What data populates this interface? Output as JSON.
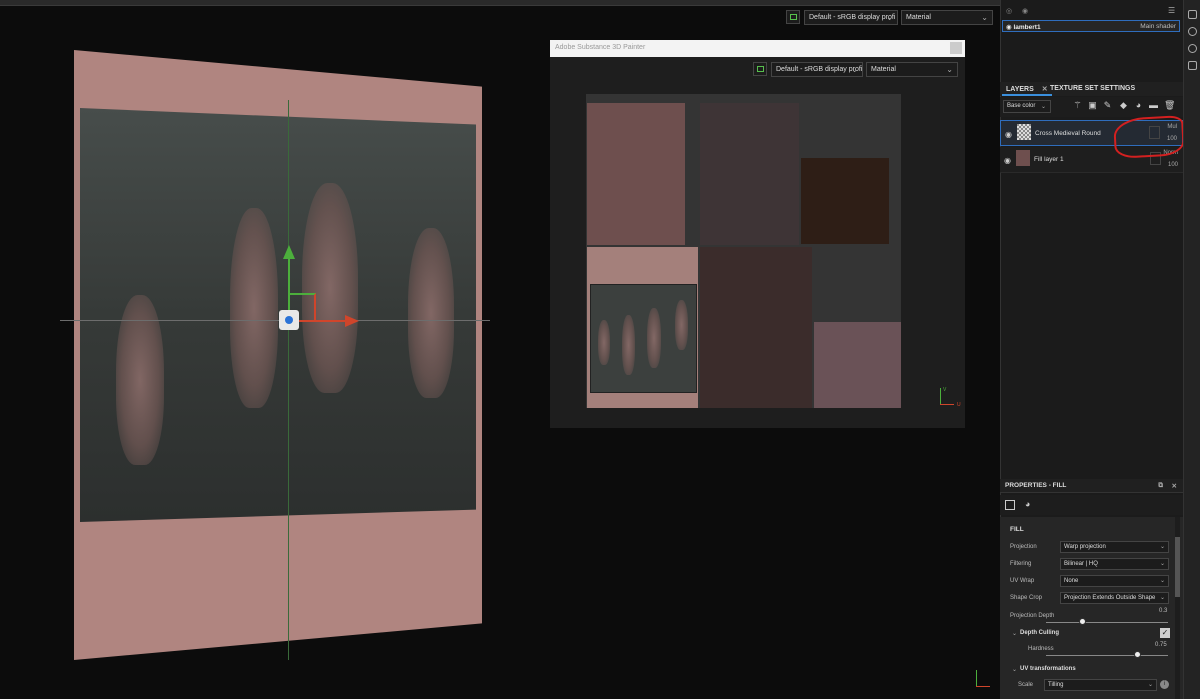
{
  "viewport3d": {
    "color_profile": "Default - sRGB display profi",
    "channel": "Material"
  },
  "uv_window": {
    "title": "Adobe Substance 3D Painter",
    "color_profile": "Default - sRGB display profi",
    "channel": "Material",
    "axis_v": "V",
    "axis_u": "U"
  },
  "shader": {
    "name": "lambert1",
    "type": "Main shader"
  },
  "tabs": [
    {
      "label": "LAYERS",
      "active": true
    },
    {
      "label": "TEXTURE SET SETTINGS",
      "active": false
    }
  ],
  "layers_toolbar": {
    "channel": "Base color"
  },
  "layers": [
    {
      "name": "Cross Medieval Round",
      "blend": "Mul",
      "opacity": "100",
      "selected": true
    },
    {
      "name": "Fill layer 1",
      "blend": "Norm",
      "opacity": "100",
      "selected": false
    }
  ],
  "properties": {
    "title": "PROPERTIES - FILL",
    "section": "FILL",
    "projection_label": "Projection",
    "projection_value": "Warp projection",
    "filtering_label": "Filtering",
    "filtering_value": "Bilinear | HQ",
    "uvwrap_label": "UV Wrap",
    "uvwrap_value": "None",
    "shapecrop_label": "Shape Crop",
    "shapecrop_value": "Projection Extends Outside Shape",
    "projdepth_label": "Projection Depth",
    "projdepth_value": "0.3",
    "projdepth_fraction": 0.3,
    "depthculling_label": "Depth Culling",
    "hardness_label": "Hardness",
    "hardness_value": "0.75",
    "hardness_fraction": 0.75,
    "uvtransform_label": "UV transformations",
    "scale_label": "Scale",
    "scale_value": "Tilling"
  },
  "colors": {
    "accent": "#2f6dbd",
    "annotation_red": "#d32020",
    "plane": "#b08580"
  }
}
